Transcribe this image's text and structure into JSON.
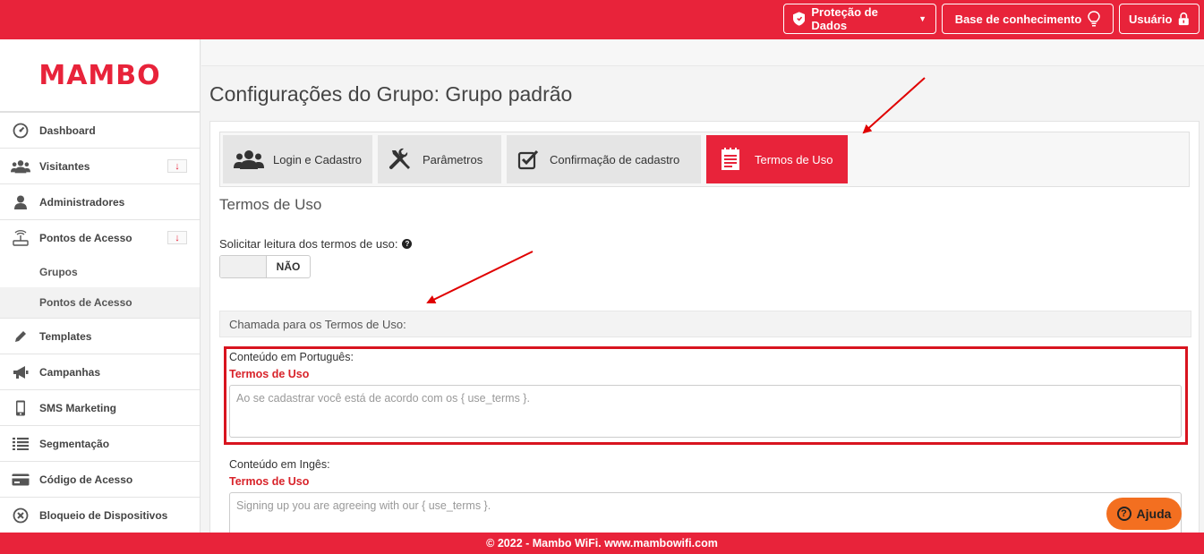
{
  "topbar": {
    "data_protection": "Proteção de Dados",
    "knowledge_base": "Base de conhecimento",
    "user": "Usuário"
  },
  "sidebar": {
    "logo": "MAMBO",
    "items": [
      {
        "label": "Dashboard",
        "icon": "dashboard-icon"
      },
      {
        "label": "Visitantes",
        "icon": "users-icon",
        "badge": "↓"
      },
      {
        "label": "Administradores",
        "icon": "user-icon"
      },
      {
        "label": "Pontos de Acesso",
        "icon": "router-icon",
        "badge": "↓"
      },
      {
        "label": "Templates",
        "icon": "pencil-icon"
      },
      {
        "label": "Campanhas",
        "icon": "megaphone-icon"
      },
      {
        "label": "SMS Marketing",
        "icon": "phone-icon"
      },
      {
        "label": "Segmentação",
        "icon": "list-icon"
      },
      {
        "label": "Código de Acesso",
        "icon": "card-icon"
      },
      {
        "label": "Bloqueio de Dispositivos",
        "icon": "block-icon"
      }
    ],
    "subitems": [
      "Grupos",
      "Pontos de Acesso"
    ]
  },
  "main": {
    "title": "Configurações do Grupo: Grupo padrão",
    "tabs": [
      {
        "label": "Login e Cadastro"
      },
      {
        "label": "Parâmetros"
      },
      {
        "label": "Confirmação de cadastro"
      },
      {
        "label": "Termos de Uso"
      }
    ],
    "section_title": "Termos de Uso",
    "read_terms_label": "Solicitar leitura dos termos de uso:",
    "toggle_state": "NÃO",
    "call_header": "Chamada para os Termos de Uso:",
    "pt": {
      "label": "Conteúdo em Português:",
      "sub": "Termos de Uso",
      "placeholder": "Ao se cadastrar você está de acordo com os { use_terms }."
    },
    "en": {
      "label": "Conteúdo em Ingês:",
      "sub": "Termos de Uso",
      "placeholder": "Signing up you are agreeing with our { use_terms }."
    }
  },
  "help_button": "Ajuda",
  "footer": "© 2022 - Mambo WiFi. www.mambowifi.com",
  "colors": {
    "brand": "#e8233a",
    "help": "#f36f20",
    "highlight": "#d8141f"
  }
}
